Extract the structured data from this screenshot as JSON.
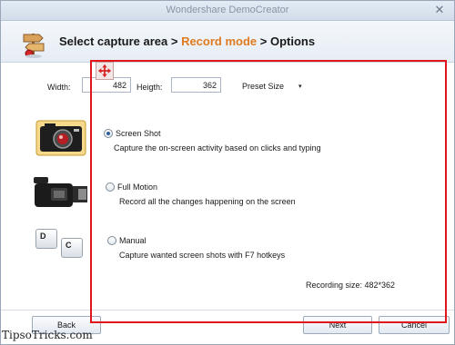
{
  "window": {
    "title": "Wondershare DemoCreator",
    "close_glyph": "✕"
  },
  "steps": {
    "step1": "Select capture area",
    "sep1": " > ",
    "step2": "Record mode",
    "sep2": " > ",
    "step3": "Options",
    "active_color": "#e07a1f"
  },
  "size": {
    "width_label": "Width:",
    "width_value": "482",
    "height_label": "Heigth:",
    "height_value": "362",
    "preset_label": "Preset Size",
    "preset_caret": "▾"
  },
  "modes": [
    {
      "icon": "camera-icon",
      "title": "Screen Shot",
      "description": "Capture the on-screen activity based on clicks and typing",
      "selected": true
    },
    {
      "icon": "video-camera-icon",
      "title": "Full Motion",
      "description": "Record all the changes happening on the screen",
      "selected": false
    },
    {
      "icon": "keyboard-keys-icon",
      "title": "Manual",
      "description": "Capture wanted screen shots with F7 hotkeys",
      "selected": false,
      "keys": [
        "D",
        "C"
      ]
    }
  ],
  "recording_size": "Recording size: 482*362",
  "buttons": {
    "back": "Back",
    "next": "Next",
    "cancel": "Cancel"
  },
  "watermark": "TipsoTricks.com",
  "colors": {
    "capture_frame": "#e0161c",
    "selected_radio": "#2d5e9e"
  }
}
